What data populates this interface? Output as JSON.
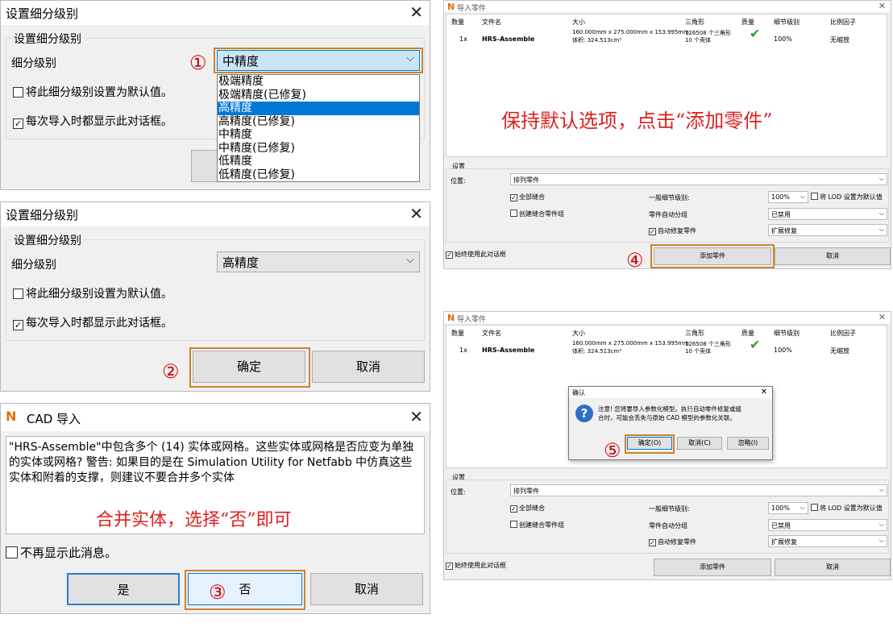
{
  "lod_dialog_1": {
    "title": "设置细分级别",
    "group_title": "设置细分级别",
    "level_label": "细分级别",
    "selected": "中精度",
    "dropdown_options": [
      "极端精度",
      "极端精度(已修复)",
      "高精度",
      "高精度(已修复)",
      "中精度",
      "中精度(已修复)",
      "低精度",
      "低精度(已修复)"
    ],
    "highlighted_option": "高精度",
    "default_checkbox": "将此细分级别设置为默认值。",
    "show_checkbox": "每次导入时都显示此对话框。",
    "step": "①"
  },
  "lod_dialog_2": {
    "title": "设置细分级别",
    "group_title": "设置细分级别",
    "level_label": "细分级别",
    "selected": "高精度",
    "default_checkbox": "将此细分级别设置为默认值。",
    "show_checkbox": "每次导入时都显示此对话框。",
    "ok": "确定",
    "cancel": "取消",
    "step": "②"
  },
  "cad_dialog": {
    "title": "CAD 导入",
    "message": "\"HRS-Assemble\"中包含多个 (14) 实体或网格。这些实体或网格是否应变为单独的实体或网格? 警告: 如果目的是在 Simulation Utility for Netfabb 中仿真这些实体和附着的支撑，则建议不要合并多个实体",
    "note": "合并实体，选择“否”即可",
    "dont_show": "不再显示此消息。",
    "yes": "是",
    "no": "否",
    "cancel": "取消",
    "step": "③"
  },
  "import_dialog": {
    "title": "导入零件",
    "columns": [
      "数量",
      "文件名",
      "大小",
      "三角形",
      "质量",
      "细节级别",
      "比例因子"
    ],
    "row": {
      "qty": "1x",
      "file": "HRS-Assemble",
      "size": "160.000mm x 275.000mm x 153.995mm",
      "volume": "体积: 324.513cm³",
      "triangles": "126508 个三角形",
      "shells": "10 个壳体",
      "lod": "100%",
      "scale": "无缩放"
    },
    "note": "保持默认选项，点击“添加零件”",
    "settings_label": "设置",
    "position_label": "位置:",
    "position_value": "排列零件",
    "all_stitch": "全部缝合",
    "create_group": "创建缝合零件组",
    "general_lod_label": "一般细节级别:",
    "general_lod_value": "100%",
    "lod_default": "将 LOD 设置为默认值",
    "auto_group_label": "零件自动分组",
    "auto_group_value": "已禁用",
    "auto_repair": "自动修复零件",
    "auto_repair_value": "扩展修复",
    "always_use": "始终使用此对话框",
    "add_parts": "添加零件",
    "cancel": "取消",
    "step": "④"
  },
  "confirm_dialog": {
    "title": "确认",
    "message_line1": "注意! 您将要导入参数化模型。执行自动零件修复或缝",
    "message_line2": "合时，可能会丢失与原始 CAD 模型的参数化关联。",
    "ok": "确定(O)",
    "cancel": "取消(C)",
    "ignore": "忽略(I)",
    "step": "⑤"
  }
}
